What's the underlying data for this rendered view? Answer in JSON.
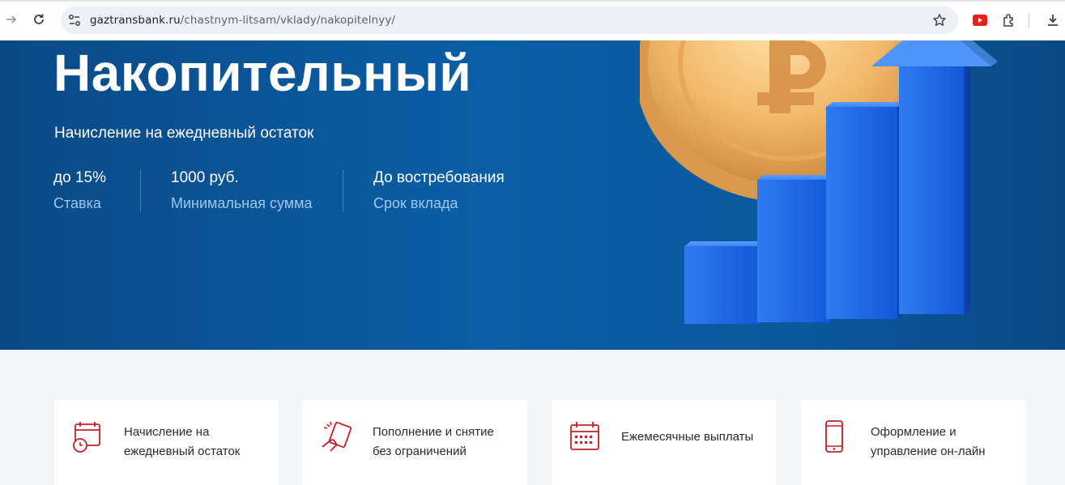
{
  "browser": {
    "url_host": "gaztransbank.ru",
    "url_path": "/chastnym-litsam/vklady/nakopitelnyy/"
  },
  "hero": {
    "title": "Накопительный",
    "subtitle": "Начисление на ежедневный остаток",
    "stats": [
      {
        "value": "до 15%",
        "label": "Ставка"
      },
      {
        "value": "1000 руб.",
        "label": "Минимальная сумма"
      },
      {
        "value": "До востребования",
        "label": "Срок вклада"
      }
    ]
  },
  "features": [
    {
      "line1": "Начисление на",
      "line2": "ежедневный остаток",
      "icon": "calendar-clock-icon"
    },
    {
      "line1": "Пополнение и снятие",
      "line2": "без ограничений",
      "icon": "hand-card-icon"
    },
    {
      "line1": "Ежемесячные выплаты",
      "line2": "",
      "icon": "calendar-icon"
    },
    {
      "line1": "Оформление и",
      "line2": "управление он-лайн",
      "icon": "smartphone-icon"
    }
  ],
  "colors": {
    "hero_blue": "#0a5ea5",
    "accent_red": "#c0202a",
    "muted_label": "#9ec7ec"
  }
}
